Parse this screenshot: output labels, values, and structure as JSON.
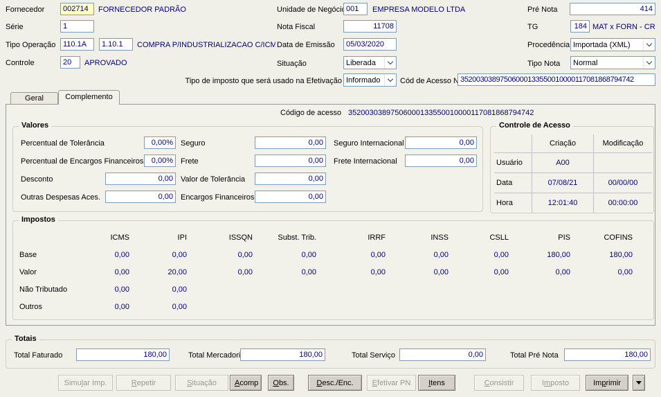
{
  "header": {
    "fornecedor": {
      "label": "Fornecedor",
      "code": "002714",
      "name": "FORNECEDOR PADRÃO"
    },
    "serie": {
      "label": "Série",
      "value": "1"
    },
    "tipo_operacao": {
      "label": "Tipo Operação",
      "code1": "110.1A",
      "code2": "1.10.1",
      "desc": "COMPRA P/INDUSTRIALIZACAO C/ICMS ("
    },
    "controle": {
      "label": "Controle",
      "code": "20",
      "status": "APROVADO"
    },
    "unidade_negocio": {
      "label": "Unidade de Negócio",
      "code": "001",
      "name": "EMPRESA MODELO LTDA"
    },
    "nota_fiscal": {
      "label": "Nota Fiscal",
      "value": "11708"
    },
    "data_emissao": {
      "label": "Data de Emissão",
      "value": "05/03/2020"
    },
    "situacao": {
      "label": "Situação",
      "value": "Liberada"
    },
    "tipo_imposto": {
      "label": "Tipo de imposto que será usado na Efetivação",
      "value": "Informado"
    },
    "cod_acesso_nfe": {
      "label": "Cód de Acesso NFe",
      "value": "35200303897506000133550010000117081868794742"
    },
    "pre_nota": {
      "label": "Pré Nota",
      "value": "414"
    },
    "tg": {
      "label": "TG",
      "code": "184",
      "desc": "MAT x FORN - CR"
    },
    "procedencia": {
      "label": "Procedência",
      "value": "Importada (XML)"
    },
    "tipo_nota": {
      "label": "Tipo Nota",
      "value": "Normal"
    }
  },
  "tabs": {
    "geral": "Geral",
    "complemento": "Complemento"
  },
  "codigo_acesso": {
    "label": "Código de acesso",
    "value": "35200303897506000133550010000117081868794742"
  },
  "valores": {
    "title": "Valores",
    "perc_tolerancia": {
      "label": "Percentual de Tolerância",
      "value": "0,00%"
    },
    "perc_encargos": {
      "label": "Percentual de Encargos Financeiros",
      "value": "0,00%"
    },
    "desconto": {
      "label": "Desconto",
      "value": "0,00"
    },
    "outras_despesas": {
      "label": "Outras Despesas Aces.",
      "value": "0,00"
    },
    "seguro": {
      "label": "Seguro",
      "value": "0,00"
    },
    "frete": {
      "label": "Frete",
      "value": "0,00"
    },
    "valor_tolerancia": {
      "label": "Valor de Tolerância",
      "value": "0,00"
    },
    "encargos_financeiros": {
      "label": "Encargos Financeiros",
      "value": "0,00"
    },
    "seguro_internacional": {
      "label": "Seguro Internacional",
      "value": "0,00"
    },
    "frete_internacional": {
      "label": "Frete Internacional",
      "value": "0,00"
    }
  },
  "controle_acesso": {
    "title": "Controle de Acesso",
    "col_criacao": "Criação",
    "col_modificacao": "Modificação",
    "rows": [
      {
        "label": "Usuário",
        "criacao": "A00",
        "modificacao": ""
      },
      {
        "label": "Data",
        "criacao": "07/08/21",
        "modificacao": "00/00/00"
      },
      {
        "label": "Hora",
        "criacao": "12:01:40",
        "modificacao": "00:00:00"
      }
    ]
  },
  "impostos": {
    "title": "Impostos",
    "columns": [
      "ICMS",
      "IPI",
      "ISSQN",
      "Subst. Trib.",
      "IRRF",
      "INSS",
      "CSLL",
      "PIS",
      "COFINS"
    ],
    "rows": [
      {
        "label": "Base",
        "values": [
          "0,00",
          "0,00",
          "0,00",
          "0,00",
          "0,00",
          "0,00",
          "0,00",
          "180,00",
          "180,00"
        ]
      },
      {
        "label": "Valor",
        "values": [
          "0,00",
          "20,00",
          "0,00",
          "0,00",
          "0,00",
          "0,00",
          "0,00",
          "0,00",
          "0,00"
        ]
      },
      {
        "label": "Não Tributado",
        "values": [
          "0,00",
          "0,00",
          "",
          "",
          "",
          "",
          "",
          "",
          ""
        ]
      },
      {
        "label": "Outros",
        "values": [
          "0,00",
          "0,00",
          "",
          "",
          "",
          "",
          "",
          "",
          ""
        ]
      }
    ]
  },
  "totais": {
    "title": "Totais",
    "total_faturado": {
      "label": "Total Faturado",
      "value": "180,00"
    },
    "total_mercadorias": {
      "label": "Total Mercadorias",
      "value": "180,00"
    },
    "total_servico": {
      "label": "Total Serviço",
      "value": "0,00"
    },
    "total_pre_nota": {
      "label": "Total Pré Nota",
      "value": "180,00"
    }
  },
  "buttons": [
    {
      "pre": "Simu",
      "key": "l",
      "post": "ar Imp.",
      "enabled": false
    },
    {
      "pre": "",
      "key": "R",
      "post": "epetir",
      "enabled": false
    },
    {
      "pre": "",
      "key": "S",
      "post": "ituação",
      "enabled": false
    },
    {
      "pre": "",
      "key": "A",
      "post": "comp",
      "enabled": true
    },
    {
      "pre": "",
      "key": "O",
      "post": "bs.",
      "enabled": true
    },
    {
      "pre": "",
      "key": "D",
      "post": "esc./Enc.",
      "enabled": true
    },
    {
      "pre": "",
      "key": "E",
      "post": "fetivar PN",
      "enabled": false
    },
    {
      "pre": "",
      "key": "I",
      "post": "tens",
      "enabled": true
    },
    {
      "pre": "",
      "key": "C",
      "post": "onsistir",
      "enabled": false
    },
    {
      "pre": "I",
      "key": "m",
      "post": "posto",
      "enabled": false
    },
    {
      "pre": "Im",
      "key": "p",
      "post": "rimir",
      "enabled": true
    }
  ],
  "colors": {
    "accent_text": "#000080",
    "highlight_field": "#ffffc2",
    "window_bg": "#f0efe8"
  }
}
